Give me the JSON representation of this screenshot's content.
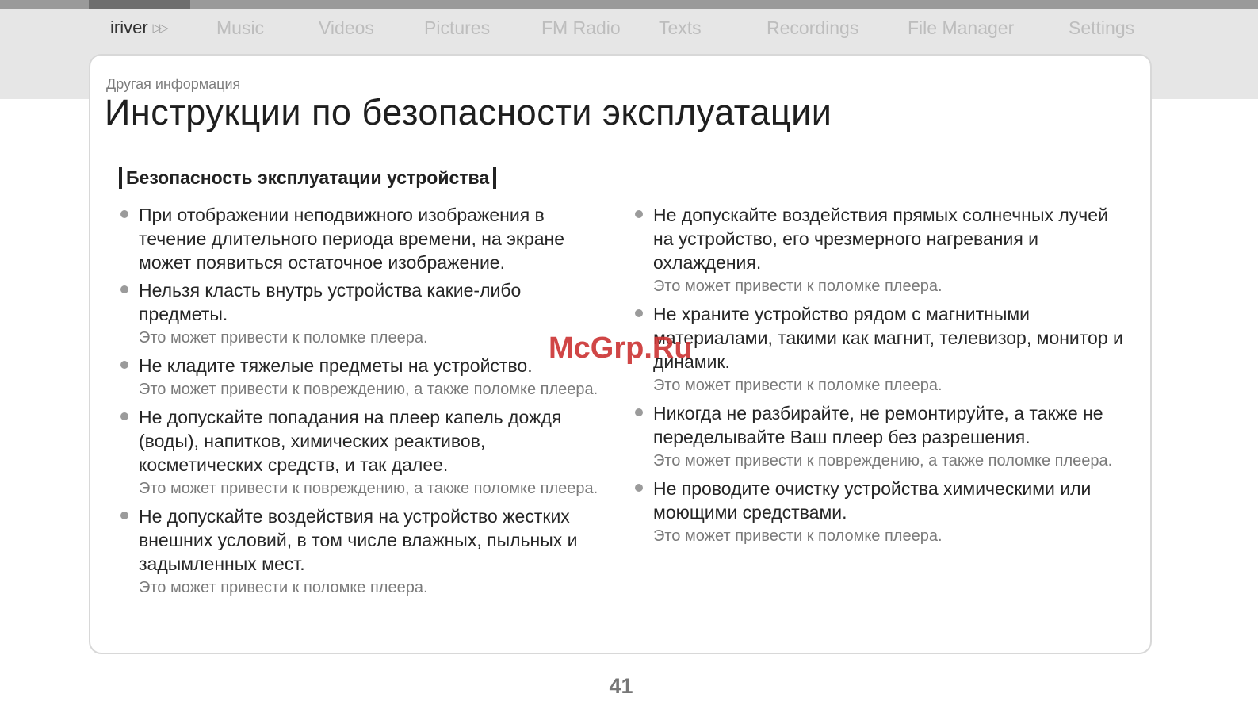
{
  "nav": {
    "brand": "iriver",
    "brand_icon": "double-chevron-right-icon",
    "items": [
      "Music",
      "Videos",
      "Pictures",
      "FM Radio",
      "Texts",
      "Recordings",
      "File Manager",
      "Settings"
    ]
  },
  "section_label": "Другая информация",
  "page_title": "Инструкции по безопасности эксплуатации",
  "subheading": "Безопасность эксплуатации устройства",
  "left_items": [
    {
      "text": "При отображении неподвижного изображения в течение длительного периода времени, на экране может появиться остаточное изображение.",
      "note": ""
    },
    {
      "text": "Нельзя класть внутрь устройства какие-либо предметы.",
      "note": "Это может привести к поломке плеера."
    },
    {
      "text": "Не кладите тяжелые предметы на устройство.",
      "note": "Это может привести к повреждению, а также поломке плеера."
    },
    {
      "text": "Не допускайте попадания на плеер капель дождя (воды), напитков, химических реактивов, косметических средств, и так далее.",
      "note": "Это может привести к повреждению, а также поломке плеера."
    },
    {
      "text": "Не допускайте воздействия на устройство жестких внешних условий, в том числе влажных, пыльных и задымленных мест.",
      "note": "Это может привести к поломке плеера."
    }
  ],
  "right_items": [
    {
      "text": "Не допускайте воздействия прямых солнечных лучей на устройство, его чрезмерного нагревания и охлаждения.",
      "note": "Это может привести к поломке плеера."
    },
    {
      "text": "Не храните устройство рядом с магнитными материалами, такими как магнит, телевизор, монитор и динамик.",
      "note": "Это может привести к поломке плеера."
    },
    {
      "text": "Никогда не разбирайте, не ремонтируйте, а также не переделывайте Ваш плеер без разрешения.",
      "note": "Это может привести к повреждению, а также поломке плеера."
    },
    {
      "text": "Не проводите очистку устройства химическими или моющими средствами.",
      "note": "Это может привести к поломке плеера."
    }
  ],
  "watermark": "McGrp.Ru",
  "page_number": "41",
  "colors": {
    "accent_watermark": "#cc3333",
    "nav_inactive": "#bdbdbd",
    "note_gray": "#7a7a7a"
  }
}
